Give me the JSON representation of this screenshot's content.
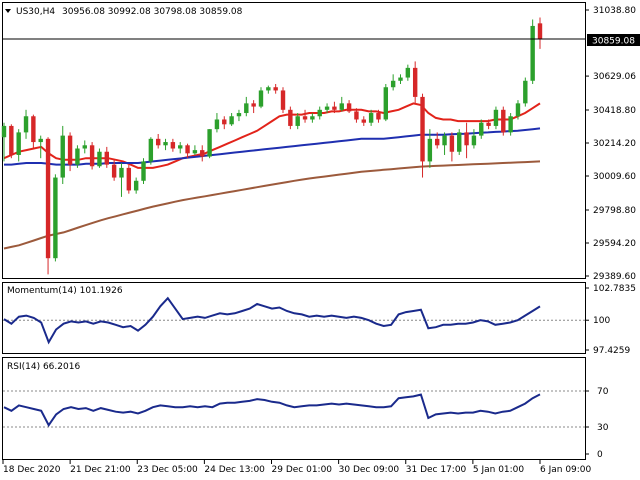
{
  "header": {
    "symbol_label": "US30,H4",
    "ohlc_label": "30956.08 30992.08 30798.08 30859.08"
  },
  "price_label": "30859.08",
  "colors": {
    "bull": "#2ca02c",
    "bear": "#d62728",
    "ma_fast": "#e2231a",
    "ma_mid": "#1f2fb0",
    "ma_slow": "#9c5a3c",
    "indicator": "#1a2a8c",
    "grid": "#888888"
  },
  "chart_data": [
    {
      "type": "candlestick",
      "title": "US30,H4",
      "yticks": [
        "31038.80",
        "30629.06",
        "30418.80",
        "30214.20",
        "30009.60",
        "29798.80",
        "29594.20",
        "29389.60"
      ],
      "ylim": [
        29389.6,
        31038.8
      ],
      "x_tick_labels": [
        "18 Dec 2020",
        "21 Dec 21:00",
        "23 Dec 05:00",
        "24 Dec 13:00",
        "29 Dec 01:00",
        "30 Dec 09:00",
        "31 Dec 17:00",
        "5 Jan 01:00",
        "6 Jan 09:00"
      ],
      "current_price": 30859.08,
      "candles": [
        {
          "o": 30250,
          "h": 30340,
          "l": 30100,
          "c": 30320
        },
        {
          "o": 30320,
          "h": 30330,
          "l": 30120,
          "c": 30140
        },
        {
          "o": 30140,
          "h": 30300,
          "l": 30100,
          "c": 30280
        },
        {
          "o": 30280,
          "h": 30420,
          "l": 30240,
          "c": 30380
        },
        {
          "o": 30380,
          "h": 30390,
          "l": 30180,
          "c": 30220
        },
        {
          "o": 30220,
          "h": 30260,
          "l": 30120,
          "c": 30240
        },
        {
          "o": 30240,
          "h": 30250,
          "l": 29400,
          "c": 29500
        },
        {
          "o": 29500,
          "h": 30020,
          "l": 29480,
          "c": 30000
        },
        {
          "o": 30000,
          "h": 30320,
          "l": 29960,
          "c": 30260
        },
        {
          "o": 30260,
          "h": 30280,
          "l": 30040,
          "c": 30080
        },
        {
          "o": 30080,
          "h": 30200,
          "l": 30060,
          "c": 30180
        },
        {
          "o": 30180,
          "h": 30230,
          "l": 30150,
          "c": 30200
        },
        {
          "o": 30200,
          "h": 30220,
          "l": 30050,
          "c": 30070
        },
        {
          "o": 30070,
          "h": 30180,
          "l": 30060,
          "c": 30160
        },
        {
          "o": 30160,
          "h": 30190,
          "l": 30060,
          "c": 30080
        },
        {
          "o": 30080,
          "h": 30110,
          "l": 29980,
          "c": 30000
        },
        {
          "o": 30000,
          "h": 30090,
          "l": 29880,
          "c": 30060
        },
        {
          "o": 30060,
          "h": 30080,
          "l": 29900,
          "c": 29920
        },
        {
          "o": 29920,
          "h": 30000,
          "l": 29900,
          "c": 29980
        },
        {
          "o": 29980,
          "h": 30120,
          "l": 29960,
          "c": 30100
        },
        {
          "o": 30100,
          "h": 30250,
          "l": 30080,
          "c": 30240
        },
        {
          "o": 30240,
          "h": 30270,
          "l": 30180,
          "c": 30200
        },
        {
          "o": 30200,
          "h": 30240,
          "l": 30170,
          "c": 30220
        },
        {
          "o": 30220,
          "h": 30240,
          "l": 30160,
          "c": 30180
        },
        {
          "o": 30180,
          "h": 30220,
          "l": 30150,
          "c": 30200
        },
        {
          "o": 30200,
          "h": 30210,
          "l": 30120,
          "c": 30150
        },
        {
          "o": 30150,
          "h": 30200,
          "l": 30140,
          "c": 30170
        },
        {
          "o": 30170,
          "h": 30200,
          "l": 30100,
          "c": 30130
        },
        {
          "o": 30130,
          "h": 30300,
          "l": 30120,
          "c": 30300
        },
        {
          "o": 30300,
          "h": 30400,
          "l": 30280,
          "c": 30360
        },
        {
          "o": 30360,
          "h": 30380,
          "l": 30300,
          "c": 30330
        },
        {
          "o": 30330,
          "h": 30400,
          "l": 30320,
          "c": 30380
        },
        {
          "o": 30380,
          "h": 30420,
          "l": 30350,
          "c": 30400
        },
        {
          "o": 30400,
          "h": 30500,
          "l": 30380,
          "c": 30460
        },
        {
          "o": 30460,
          "h": 30480,
          "l": 30400,
          "c": 30440
        },
        {
          "o": 30440,
          "h": 30560,
          "l": 30430,
          "c": 30540
        },
        {
          "o": 30540,
          "h": 30570,
          "l": 30520,
          "c": 30560
        },
        {
          "o": 30560,
          "h": 30580,
          "l": 30520,
          "c": 30540
        },
        {
          "o": 30540,
          "h": 30560,
          "l": 30400,
          "c": 30420
        },
        {
          "o": 30420,
          "h": 30440,
          "l": 30300,
          "c": 30320
        },
        {
          "o": 30320,
          "h": 30400,
          "l": 30300,
          "c": 30380
        },
        {
          "o": 30380,
          "h": 30420,
          "l": 30340,
          "c": 30360
        },
        {
          "o": 30360,
          "h": 30400,
          "l": 30340,
          "c": 30380
        },
        {
          "o": 30380,
          "h": 30440,
          "l": 30360,
          "c": 30420
        },
        {
          "o": 30420,
          "h": 30460,
          "l": 30400,
          "c": 30440
        },
        {
          "o": 30440,
          "h": 30470,
          "l": 30400,
          "c": 30420
        },
        {
          "o": 30420,
          "h": 30500,
          "l": 30410,
          "c": 30460
        },
        {
          "o": 30460,
          "h": 30480,
          "l": 30400,
          "c": 30410
        },
        {
          "o": 30410,
          "h": 30430,
          "l": 30340,
          "c": 30360
        },
        {
          "o": 30360,
          "h": 30380,
          "l": 30320,
          "c": 30340
        },
        {
          "o": 30340,
          "h": 30420,
          "l": 30320,
          "c": 30400
        },
        {
          "o": 30400,
          "h": 30420,
          "l": 30340,
          "c": 30360
        },
        {
          "o": 30360,
          "h": 30580,
          "l": 30350,
          "c": 30560
        },
        {
          "o": 30560,
          "h": 30640,
          "l": 30540,
          "c": 30600
        },
        {
          "o": 30600,
          "h": 30640,
          "l": 30580,
          "c": 30620
        },
        {
          "o": 30620,
          "h": 30700,
          "l": 30600,
          "c": 30680
        },
        {
          "o": 30680,
          "h": 30720,
          "l": 30460,
          "c": 30500
        },
        {
          "o": 30500,
          "h": 30520,
          "l": 30000,
          "c": 30100
        },
        {
          "o": 30100,
          "h": 30300,
          "l": 30060,
          "c": 30240
        },
        {
          "o": 30240,
          "h": 30280,
          "l": 30180,
          "c": 30200
        },
        {
          "o": 30200,
          "h": 30280,
          "l": 30140,
          "c": 30260
        },
        {
          "o": 30260,
          "h": 30280,
          "l": 30100,
          "c": 30160
        },
        {
          "o": 30160,
          "h": 30300,
          "l": 30140,
          "c": 30280
        },
        {
          "o": 30280,
          "h": 30340,
          "l": 30120,
          "c": 30200
        },
        {
          "o": 30200,
          "h": 30300,
          "l": 30180,
          "c": 30260
        },
        {
          "o": 30260,
          "h": 30360,
          "l": 30240,
          "c": 30340
        },
        {
          "o": 30340,
          "h": 30360,
          "l": 30300,
          "c": 30320
        },
        {
          "o": 30320,
          "h": 30440,
          "l": 30300,
          "c": 30420
        },
        {
          "o": 30420,
          "h": 30440,
          "l": 30260,
          "c": 30280
        },
        {
          "o": 30280,
          "h": 30400,
          "l": 30260,
          "c": 30380
        },
        {
          "o": 30380,
          "h": 30480,
          "l": 30360,
          "c": 30460
        },
        {
          "o": 30460,
          "h": 30620,
          "l": 30440,
          "c": 30600
        },
        {
          "o": 30600,
          "h": 30980,
          "l": 30580,
          "c": 30940
        },
        {
          "o": 30956.08,
          "h": 30992.08,
          "l": 30798.08,
          "c": 30859.08
        }
      ],
      "series": [
        {
          "name": "MA fast",
          "values": [
            30120,
            30140,
            30160,
            30170,
            30180,
            30190,
            30150,
            30120,
            30110,
            30110,
            30110,
            30120,
            30120,
            30120,
            30120,
            30110,
            30100,
            30080,
            30060,
            30060,
            30060,
            30070,
            30080,
            30100,
            30120,
            30130,
            30140,
            30150,
            30170,
            30190,
            30210,
            30230,
            30250,
            30270,
            30290,
            30320,
            30350,
            30380,
            30390,
            30390,
            30390,
            30400,
            30400,
            30400,
            30410,
            30410,
            30420,
            30420,
            30420,
            30410,
            30410,
            30400,
            30410,
            30420,
            30440,
            30460,
            30450,
            30400,
            30370,
            30360,
            30360,
            30350,
            30350,
            30350,
            30350,
            30350,
            30360,
            30360,
            30360,
            30380,
            30400,
            30430,
            30460
          ]
        },
        {
          "name": "MA mid",
          "values": [
            30080,
            30080,
            30085,
            30090,
            30090,
            30090,
            30085,
            30080,
            30080,
            30080,
            30080,
            30085,
            30085,
            30085,
            30090,
            30090,
            30090,
            30090,
            30090,
            30095,
            30100,
            30105,
            30110,
            30115,
            30120,
            30125,
            30130,
            30135,
            30140,
            30145,
            30150,
            30155,
            30160,
            30165,
            30170,
            30175,
            30180,
            30185,
            30190,
            30195,
            30200,
            30205,
            30210,
            30215,
            30220,
            30225,
            30230,
            30235,
            30240,
            30240,
            30240,
            30240,
            30245,
            30250,
            30255,
            30260,
            30265,
            30265,
            30265,
            30265,
            30268,
            30270,
            30272,
            30275,
            30278,
            30280,
            30283,
            30285,
            30288,
            30290,
            30295,
            30300,
            30305
          ]
        },
        {
          "name": "MA slow",
          "values": [
            29560,
            29570,
            29580,
            29595,
            29610,
            29625,
            29640,
            29650,
            29660,
            29675,
            29690,
            29705,
            29720,
            29735,
            29748,
            29760,
            29772,
            29784,
            29796,
            29808,
            29820,
            29830,
            29840,
            29850,
            29860,
            29868,
            29876,
            29884,
            29892,
            29900,
            29908,
            29916,
            29924,
            29932,
            29940,
            29948,
            29956,
            29964,
            29972,
            29980,
            29987,
            29994,
            30000,
            30006,
            30012,
            30018,
            30024,
            30030,
            30036,
            30040,
            30044,
            30048,
            30052,
            30056,
            30060,
            30064,
            30068,
            30070,
            30072,
            30074,
            30076,
            30078,
            30080,
            30082,
            30084,
            30086,
            30088,
            30090,
            30092,
            30094,
            30096,
            30098,
            30100
          ]
        }
      ]
    },
    {
      "type": "line",
      "title": "Momentum(14) 101.1926",
      "yticks": [
        "102.7835",
        "100",
        "97.4259"
      ],
      "ylim": [
        97.4259,
        102.7835
      ],
      "series": [
        {
          "values": [
            100.1,
            99.7,
            100.3,
            100.4,
            100.2,
            99.8,
            98.1,
            99.2,
            99.7,
            99.9,
            99.8,
            99.9,
            99.7,
            99.9,
            99.8,
            99.6,
            99.4,
            99.5,
            99.1,
            99.6,
            100.3,
            101.2,
            101.9,
            101.0,
            100.1,
            100.2,
            100.3,
            100.2,
            100.4,
            100.6,
            100.5,
            100.6,
            100.8,
            101.0,
            101.4,
            101.2,
            101.0,
            101.1,
            100.8,
            100.6,
            100.5,
            100.3,
            100.4,
            100.3,
            100.4,
            100.3,
            100.2,
            100.3,
            100.2,
            100.0,
            99.7,
            99.5,
            99.6,
            100.5,
            100.7,
            100.8,
            100.9,
            99.3,
            99.4,
            99.6,
            99.6,
            99.7,
            99.7,
            99.8,
            100.0,
            99.9,
            99.6,
            99.7,
            99.8,
            100.0,
            100.4,
            100.8,
            101.1926
          ]
        }
      ]
    },
    {
      "type": "line",
      "title": "RSI(14) 66.2016",
      "yticks": [
        "70",
        "30",
        "0"
      ],
      "ylim": [
        0,
        100
      ],
      "series": [
        {
          "values": [
            52,
            48,
            54,
            52,
            50,
            48,
            32,
            44,
            50,
            52,
            50,
            51,
            48,
            51,
            49,
            47,
            46,
            47,
            45,
            48,
            52,
            54,
            53,
            52,
            52,
            53,
            52,
            53,
            52,
            56,
            57,
            57,
            58,
            59,
            61,
            60,
            58,
            57,
            54,
            52,
            53,
            54,
            54,
            55,
            56,
            55,
            56,
            55,
            54,
            53,
            52,
            52,
            53,
            62,
            63,
            64,
            66,
            40,
            44,
            45,
            46,
            45,
            46,
            46,
            48,
            47,
            45,
            47,
            48,
            52,
            56,
            62,
            66.2016
          ]
        }
      ]
    }
  ]
}
